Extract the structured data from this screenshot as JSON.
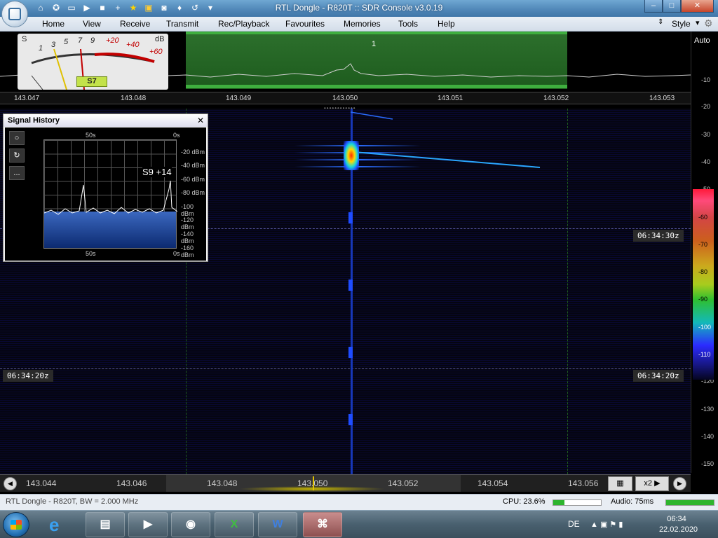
{
  "window": {
    "title": "RTL Dongle - R820T :: SDR Console v3.0.19",
    "controls": {
      "minimize": "–",
      "maximize": "□",
      "close": "✕"
    }
  },
  "quick_access_icons": [
    "home-icon",
    "lifebuoy-icon",
    "folder-icon",
    "play-icon",
    "stop-icon",
    "plus-icon",
    "star-icon",
    "lock-icon",
    "camera-icon",
    "drop-icon",
    "undo-icon",
    "dropdown-icon"
  ],
  "menu": {
    "items": [
      "Home",
      "View",
      "Receive",
      "Transmit",
      "Rec/Playback",
      "Favourites",
      "Memories",
      "Tools",
      "Help"
    ],
    "style_label": "Style"
  },
  "smeter": {
    "s_label": "S",
    "db_label": "dB",
    "scale": [
      "1",
      "3",
      "5",
      "7",
      "9",
      "+20",
      "+40",
      "+60"
    ],
    "reading": "S7"
  },
  "spectrum": {
    "vfo_number": "1",
    "auto_label": "Auto",
    "freq_ticks": [
      "143.047",
      "143.048",
      "143.049",
      "143.050",
      "143.051",
      "143.052",
      "143.053"
    ]
  },
  "right_scale": {
    "labels": [
      "-10",
      "-20",
      "-30",
      "-40",
      "-50",
      "-60",
      "-70",
      "-80",
      "-90",
      "-100",
      "-110",
      "-120",
      "-130",
      "-140",
      "-150"
    ]
  },
  "waterfall": {
    "timestamps": [
      "06:34:30z",
      "06:34:20z"
    ]
  },
  "signal_history": {
    "title": "Signal History",
    "close": "✕",
    "time_left": "50s",
    "time_right": "0s",
    "dbm_labels": [
      "-20 dBm",
      "-40 dBm",
      "-60 dBm",
      "-80 dBm",
      "-100 dBm",
      "-120 dBm",
      "-140 dBm",
      "-160 dBm"
    ],
    "reading": "S9 +14",
    "tools": [
      "○",
      "↻",
      "..."
    ]
  },
  "band": {
    "labels": [
      "143.044",
      "143.046",
      "143.048",
      "143.050",
      "143.052",
      "143.054",
      "143.056"
    ],
    "zoom": "x2"
  },
  "status": {
    "device": "RTL Dongle - R820T, BW = 2.000 MHz",
    "cpu": "CPU: 23.6%",
    "cpu_fraction": 0.236,
    "audio": "Audio: 75ms"
  },
  "taskbar": {
    "apps": [
      "ie-icon",
      "explorer-icon",
      "media-player-icon",
      "chrome-icon",
      "excel-icon",
      "word-icon",
      "sdr-console-icon"
    ],
    "language": "DE",
    "time": "06:34",
    "date": "22.02.2020"
  }
}
